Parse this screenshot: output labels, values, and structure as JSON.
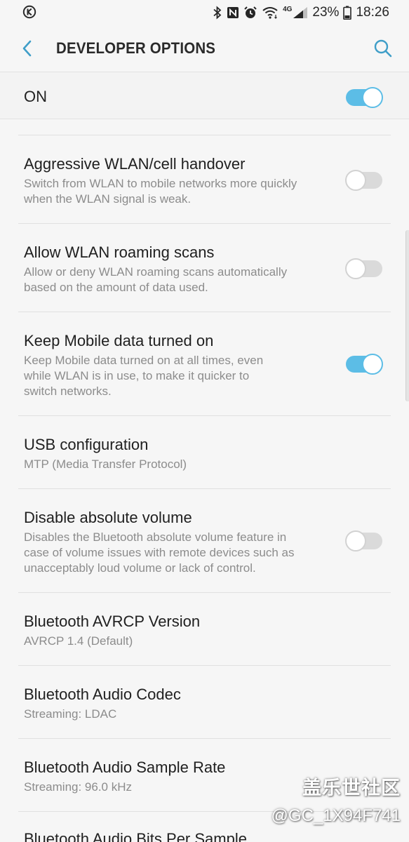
{
  "status_bar": {
    "battery_percent": "23%",
    "time": "18:26",
    "network_label": "4G",
    "icons": [
      "k-app-icon",
      "bluetooth-icon",
      "nfc-icon",
      "alarm-icon",
      "wifi-icon",
      "signal-icon",
      "battery-icon"
    ]
  },
  "app_bar": {
    "title": "DEVELOPER OPTIONS",
    "back_icon": "chevron-left-icon",
    "search_icon": "search-icon"
  },
  "master_toggle": {
    "label": "ON",
    "state": "on"
  },
  "items": [
    {
      "title": "Aggressive WLAN/cell handover",
      "summary_lines": [
        "Switch from WLAN to mobile networks more quickly",
        "when the WLAN signal is weak."
      ],
      "switch": "off"
    },
    {
      "title": "Allow WLAN roaming scans",
      "summary_lines": [
        "Allow or deny WLAN roaming scans automatically",
        "based on the amount of data used."
      ],
      "switch": "off"
    },
    {
      "title": "Keep Mobile data turned on",
      "summary_lines": [
        "Keep Mobile data turned on at all times, even",
        "while WLAN is in use, to make it quicker to",
        "switch networks."
      ],
      "switch": "on"
    },
    {
      "title": "USB configuration",
      "summary_lines": [
        "MTP (Media Transfer Protocol)"
      ],
      "switch": null
    },
    {
      "title": "Disable absolute volume",
      "summary_lines": [
        "Disables the Bluetooth absolute volume feature in",
        "case of volume issues with remote devices such as",
        "unacceptably loud volume or lack of control."
      ],
      "switch": "off"
    },
    {
      "title": "Bluetooth AVRCP Version",
      "summary_lines": [
        "AVRCP 1.4 (Default)"
      ],
      "switch": null
    },
    {
      "title": "Bluetooth Audio Codec",
      "summary_lines": [
        "Streaming: LDAC"
      ],
      "switch": null
    },
    {
      "title": "Bluetooth Audio Sample Rate",
      "summary_lines": [
        "Streaming: 96.0 kHz"
      ],
      "switch": null
    },
    {
      "title": "Bluetooth Audio Bits Per Sample",
      "summary_lines": [],
      "switch": null
    }
  ],
  "watermark": {
    "main": "盖乐世社区",
    "sub": "@GC_1X94F741"
  },
  "colors": {
    "accent": "#5cbde6",
    "background": "#f6f6f6",
    "summary_text": "#8c8c8c",
    "divider": "#e0e0e0"
  }
}
